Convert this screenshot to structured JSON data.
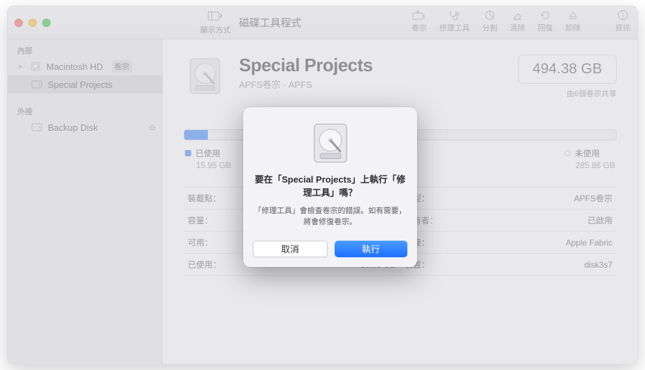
{
  "app": {
    "title": "磁碟工具程式",
    "view_mode_label": "顯示方式"
  },
  "toolbar": {
    "items": [
      {
        "label": "卷宗"
      },
      {
        "label": "修理工具"
      },
      {
        "label": "分割"
      },
      {
        "label": "清除"
      },
      {
        "label": "回復"
      },
      {
        "label": "卸除"
      }
    ],
    "info_label": "資訊"
  },
  "sidebar": {
    "internal_label": "內部",
    "external_label": "外接",
    "items": [
      {
        "name": "Macintosh HD",
        "badge": "卷宗"
      },
      {
        "name": "Special Projects"
      }
    ],
    "external_items": [
      {
        "name": "Backup Disk"
      }
    ]
  },
  "volume": {
    "name": "Special Projects",
    "subtype": "APFS卷宗 · APFS",
    "capacity": "494.38 GB",
    "shared_note": "由6個卷宗共享",
    "used_label": "已使用",
    "used_value": "15.95 GB",
    "free_label": "未使用",
    "free_value": "285.86 GB"
  },
  "info_rows": [
    {
      "l_label": "裝載點：",
      "l_value": "",
      "r_label": "類型：",
      "r_value": "APFS卷宗"
    },
    {
      "l_label": "容量：",
      "l_value": "",
      "r_label": "擁有者：",
      "r_value": "已啟用"
    },
    {
      "l_label": "可用：",
      "l_value": "",
      "r_label": "連接：",
      "r_value": "Apple Fabric"
    },
    {
      "l_label": "已使用：",
      "l_value": "15.95 GB",
      "r_label": "裝置：",
      "r_value": "disk3s7"
    }
  ],
  "dialog": {
    "title": "要在「Special Projects」上執行「修理工具」嗎？",
    "body": "「修理工具」會檢查卷宗的錯誤。如有需要，將會修復卷宗。",
    "cancel": "取消",
    "run": "執行"
  }
}
